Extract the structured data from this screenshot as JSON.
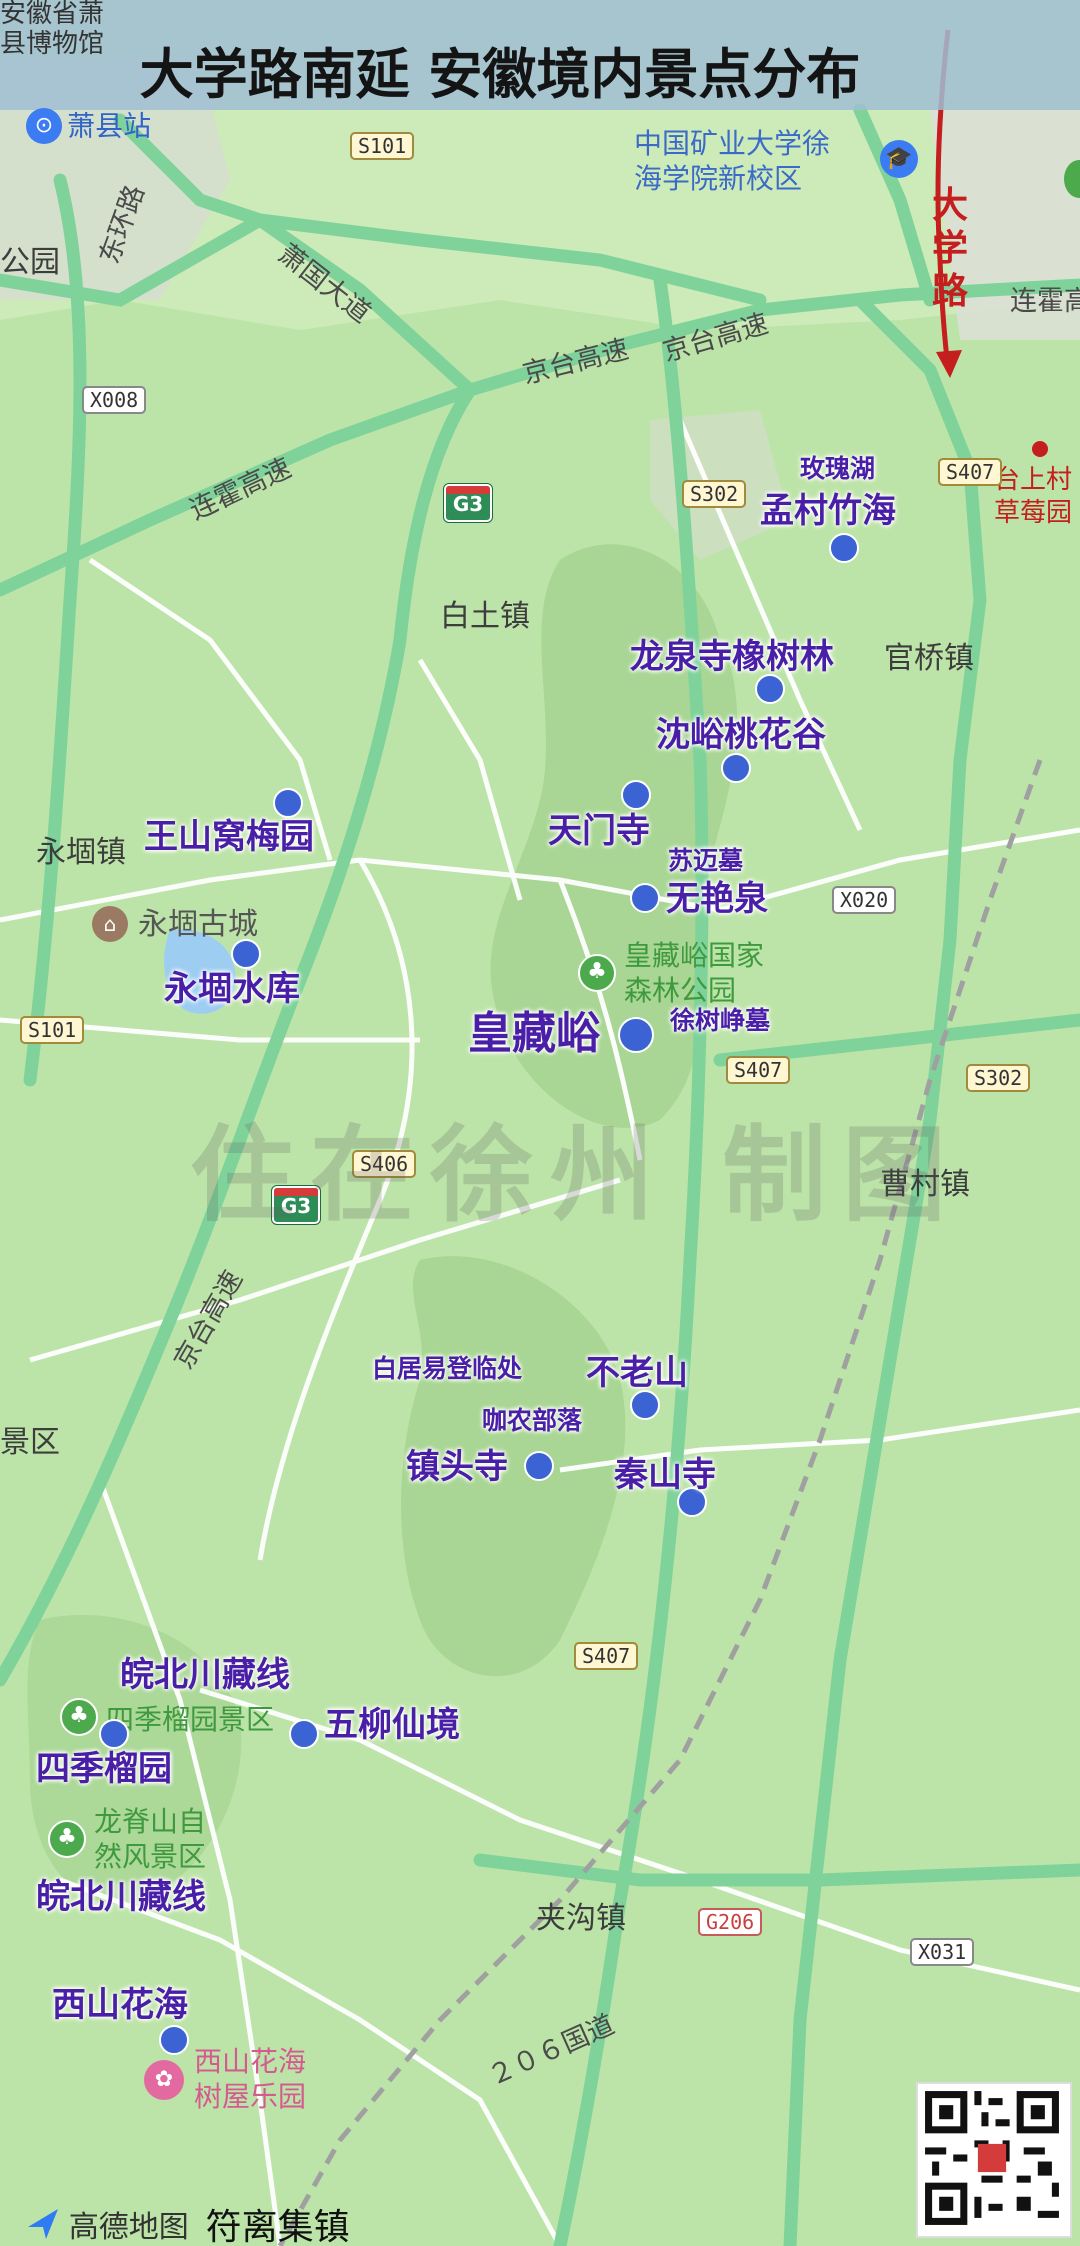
{
  "title": "大学路南延 安徽境内景点分布",
  "watermark": "住在徐州 制图",
  "brand": {
    "provider": "高德地图",
    "place": "符离集镇"
  },
  "arrow_label": "大学路",
  "top_left_labels": [
    "安徽省萧",
    "县博物馆"
  ],
  "pois": {
    "xiaoxian_station": "萧县站",
    "cumt_campus": [
      "中国矿业大学徐",
      "海学院新校区"
    ],
    "strawberry": [
      "台上村",
      "草莓园"
    ],
    "yongdui_ancient_city": "永堌古城",
    "huangzangyu_park": [
      "皇藏峪国家",
      "森林公园"
    ],
    "sijiliu_park": "四季榴园景区",
    "longjishan_park": [
      "龙脊山自",
      "然风景区"
    ],
    "xishan_park": [
      "西山花海",
      "树屋乐园"
    ]
  },
  "towns": {
    "baitu": "白土镇",
    "yongdui": "永堌镇",
    "guanqiao": "官桥镇",
    "caocun": "曹村镇",
    "jiagou": "夹沟镇",
    "park_left": "公园",
    "scenic_left": "景区"
  },
  "roads": {
    "xiaoguo": "萧国大道",
    "donghuan": "东环路",
    "jingtai_1": "京台高速",
    "jingtai_2": "京台高速",
    "jingtai_3": "京台高速",
    "lianhuo_1": "连霍高速",
    "lianhuo_2": "连霍高",
    "guodao_206": "２０６国道"
  },
  "shields": {
    "s101_top": "S101",
    "x008": "X008",
    "s302_a": "S302",
    "s407_a": "S407",
    "x020": "X020",
    "s101_left": "S101",
    "s407_b": "S407",
    "s302_b": "S302",
    "s406": "S406",
    "s407_c": "S407",
    "g206": "G206",
    "x031": "X031",
    "g3_a": "G3",
    "g3_b": "G3"
  },
  "spots": {
    "meigui_lake": "玫瑰湖",
    "mengcun": "孟村竹海",
    "longquan": "龙泉寺橡树林",
    "shenyu": "沈峪桃花谷",
    "wangshan": "王山窝梅园",
    "tianmen": "天门寺",
    "sumai": "苏迈墓",
    "wuyan": "无艳泉",
    "yongdui_reservoir": "永堌水库",
    "huangzangyu": "皇藏峪",
    "xushuzheng": "徐树峥墓",
    "baijuyi": "白居易登临处",
    "bulao": "不老山",
    "jianong": "咖农部落",
    "zhentou": "镇头寺",
    "qinshan": "秦山寺",
    "wanbei_1": "皖北川藏线",
    "wuliu": "五柳仙境",
    "sijiliu": "四季榴园",
    "wanbei_2": "皖北川藏线",
    "xishan": "西山花海"
  },
  "colors": {
    "land": "#b9e2a6",
    "road_green": "#7fd39a",
    "spot_text": "#4a1fa8",
    "dot": "#3b63d4",
    "arrow": "#c41e1e"
  }
}
